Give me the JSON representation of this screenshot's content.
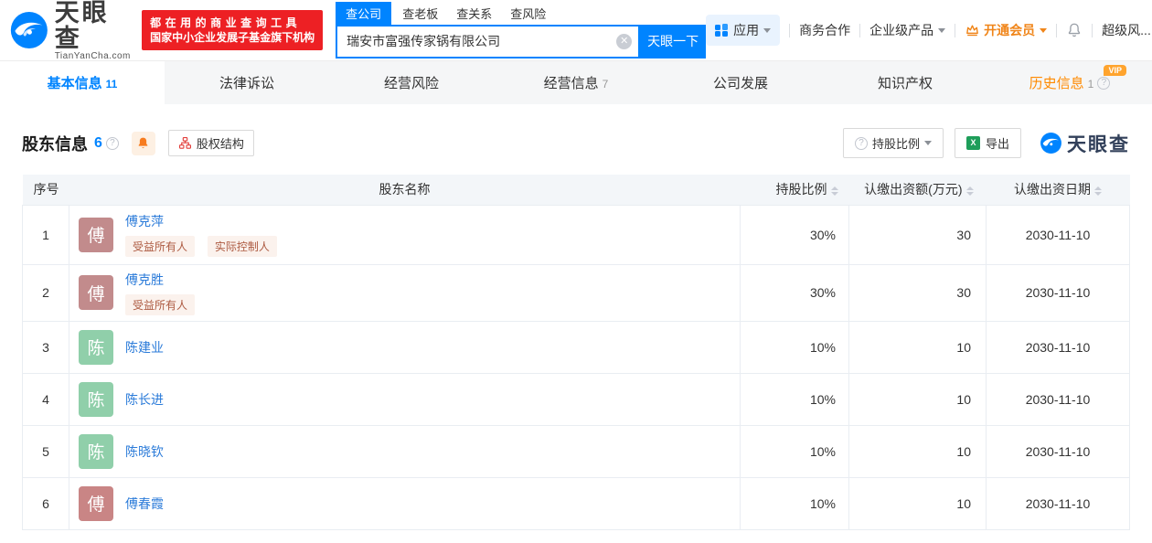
{
  "header": {
    "logo": {
      "name": "天眼查",
      "domain": "TianYanCha.com"
    },
    "banner": {
      "line1": "都在用的商业查询工具",
      "line2": "国家中小企业发展子基金旗下机构"
    },
    "search": {
      "tabs": [
        {
          "label": "查公司"
        },
        {
          "label": "查老板"
        },
        {
          "label": "查关系"
        },
        {
          "label": "查风险"
        }
      ],
      "value": "瑞安市富强传家锅有限公司",
      "submit": "天眼一下"
    },
    "nav": {
      "app": "应用",
      "cooperation": "商务合作",
      "enterprise": "企业级产品",
      "vip": "开通会员",
      "super_risk": "超级风..."
    }
  },
  "tabs": [
    {
      "label": "基本信息",
      "count": "11"
    },
    {
      "label": "法律诉讼",
      "count": ""
    },
    {
      "label": "经营风险",
      "count": ""
    },
    {
      "label": "经营信息",
      "count": "7"
    },
    {
      "label": "公司发展",
      "count": ""
    },
    {
      "label": "知识产权",
      "count": ""
    },
    {
      "label": "历史信息",
      "count": "1",
      "vip_badge": "VIP"
    }
  ],
  "section": {
    "title": "股东信息",
    "count": "6",
    "equity_structure": "股权结构",
    "ratio_filter": "持股比例",
    "export": "导出",
    "watermark": "天眼查"
  },
  "table": {
    "headers": {
      "no": "序号",
      "name": "股东名称",
      "ratio": "持股比例",
      "amount": "认缴出资额(万元)",
      "date": "认缴出资日期"
    },
    "rows": [
      {
        "no": "1",
        "avatar": "傅",
        "avatar_color": "#c28b8c",
        "name": "傅克萍",
        "tags": [
          "受益所有人",
          "实际控制人"
        ],
        "ratio": "30%",
        "amount": "30",
        "date": "2030-11-10"
      },
      {
        "no": "2",
        "avatar": "傅",
        "avatar_color": "#c28b8c",
        "name": "傅克胜",
        "tags": [
          "受益所有人"
        ],
        "ratio": "30%",
        "amount": "30",
        "date": "2030-11-10"
      },
      {
        "no": "3",
        "avatar": "陈",
        "avatar_color": "#90cfaa",
        "name": "陈建业",
        "tags": [],
        "ratio": "10%",
        "amount": "10",
        "date": "2030-11-10"
      },
      {
        "no": "4",
        "avatar": "陈",
        "avatar_color": "#90cfaa",
        "name": "陈长进",
        "tags": [],
        "ratio": "10%",
        "amount": "10",
        "date": "2030-11-10"
      },
      {
        "no": "5",
        "avatar": "陈",
        "avatar_color": "#90cfaa",
        "name": "陈晓钦",
        "tags": [],
        "ratio": "10%",
        "amount": "10",
        "date": "2030-11-10"
      },
      {
        "no": "6",
        "avatar": "傅",
        "avatar_color": "#c98585",
        "name": "傅春霞",
        "tags": [],
        "ratio": "10%",
        "amount": "10",
        "date": "2030-11-10"
      }
    ]
  },
  "colors": {
    "brand_blue": "#0084ff",
    "link_blue": "#2b7bd9",
    "orange": "#f08519",
    "banner_red": "#ed2024",
    "tag_bg": "#fbf2ed",
    "tag_text": "#ad5a41"
  }
}
